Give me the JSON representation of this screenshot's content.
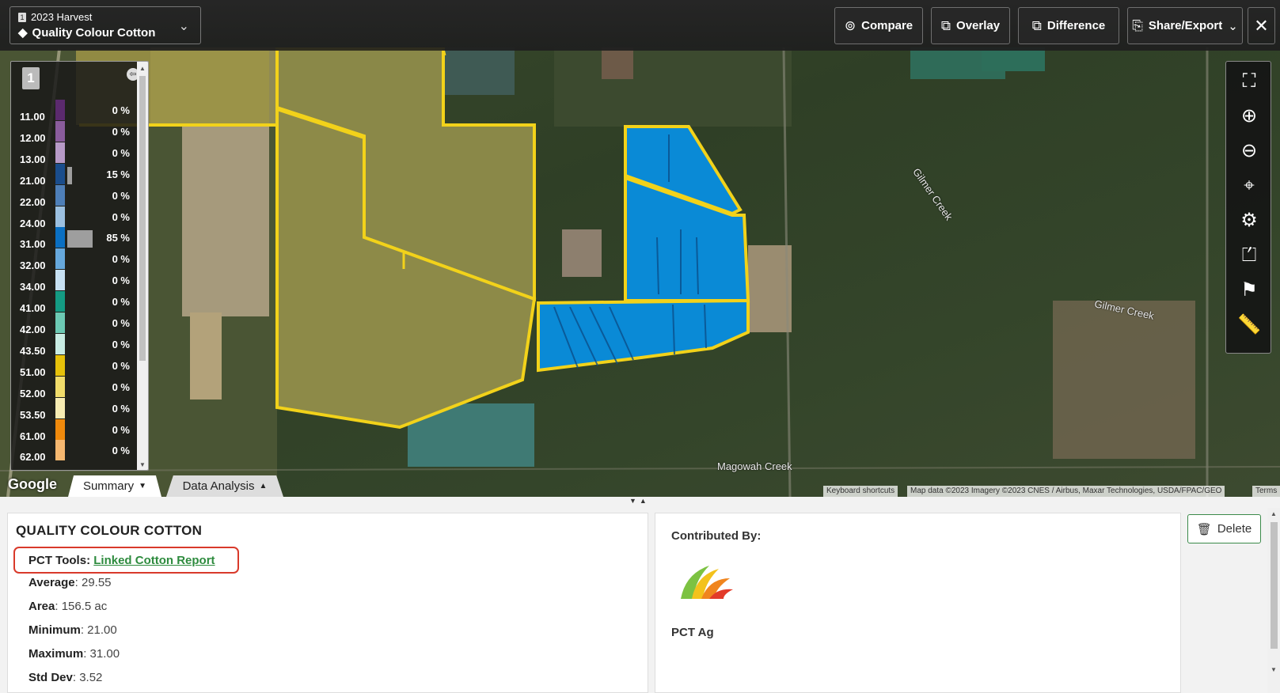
{
  "layer": {
    "number": "1",
    "season": "2023 Harvest",
    "name": "Quality Colour Cotton"
  },
  "toolbar": {
    "compare_label": "Compare",
    "overlay_label": "Overlay",
    "difference_label": "Difference",
    "share_label": "Share/Export"
  },
  "legend": {
    "badge": "1",
    "rows": [
      {
        "value": "11.00",
        "color": "#5b2a6e",
        "pct": "0 %",
        "fill": 0
      },
      {
        "value": "12.00",
        "color": "#8a5c9c",
        "pct": "0 %",
        "fill": 0
      },
      {
        "value": "13.00",
        "color": "#b79ac7",
        "pct": "0 %",
        "fill": 0
      },
      {
        "value": "21.00",
        "color": "#1a4d8c",
        "pct": "15 %",
        "fill": 0.15
      },
      {
        "value": "22.00",
        "color": "#4e7fb8",
        "pct": "0 %",
        "fill": 0
      },
      {
        "value": "24.00",
        "color": "#9cc0e0",
        "pct": "0 %",
        "fill": 0
      },
      {
        "value": "31.00",
        "color": "#0a6fc2",
        "pct": "85 %",
        "fill": 0.85
      },
      {
        "value": "32.00",
        "color": "#66a8dc",
        "pct": "0 %",
        "fill": 0
      },
      {
        "value": "34.00",
        "color": "#c6e0f2",
        "pct": "0 %",
        "fill": 0
      },
      {
        "value": "41.00",
        "color": "#149b83",
        "pct": "0 %",
        "fill": 0
      },
      {
        "value": "42.00",
        "color": "#6cc9b3",
        "pct": "0 %",
        "fill": 0
      },
      {
        "value": "43.50",
        "color": "#c8ece3",
        "pct": "0 %",
        "fill": 0
      },
      {
        "value": "51.00",
        "color": "#e6c10a",
        "pct": "0 %",
        "fill": 0
      },
      {
        "value": "52.00",
        "color": "#f1dc6a",
        "pct": "0 %",
        "fill": 0
      },
      {
        "value": "53.50",
        "color": "#f7ecb2",
        "pct": "0 %",
        "fill": 0
      },
      {
        "value": "61.00",
        "color": "#f08a0c",
        "pct": "0 %",
        "fill": 0
      },
      {
        "value": "62.00",
        "color": "#f6b870",
        "pct": "0 %",
        "fill": 0
      }
    ]
  },
  "map": {
    "labels": {
      "gilmer_creek_1": "Gilmer Creek",
      "gilmer_creek_2": "Gilmer Creek",
      "magowah_creek": "Magowah Creek"
    },
    "attribution": {
      "shortcuts": "Keyboard shortcuts",
      "data": "Map data ©2023 Imagery ©2023 CNES / Airbus, Maxar Technologies, USDA/FPAC/GEO",
      "terms": "Terms"
    },
    "google": "Google"
  },
  "tabs": {
    "summary": "Summary",
    "analysis": "Data Analysis"
  },
  "summary": {
    "title": "QUALITY COLOUR COTTON",
    "pct_tools_label": "PCT Tools",
    "pct_tools_link": "Linked Cotton Report",
    "average_label": "Average",
    "average_value": ": 29.55",
    "area_label": "Area",
    "area_value": ": 156.5 ac",
    "minimum_label": "Minimum",
    "minimum_value": ": 21.00",
    "maximum_label": "Maximum",
    "maximum_value": ": 31.00",
    "stddev_label": "Std Dev",
    "stddev_value": ": 3.52"
  },
  "contributor": {
    "title": "Contributed By:",
    "org": "PCT Ag"
  },
  "delete_label": "Delete",
  "colors": {
    "field_boundary": "#f2d21a",
    "field_fill_blue": "#0a8ad6",
    "highlight_red": "#d93a2b",
    "link_green": "#2e8b3e"
  }
}
